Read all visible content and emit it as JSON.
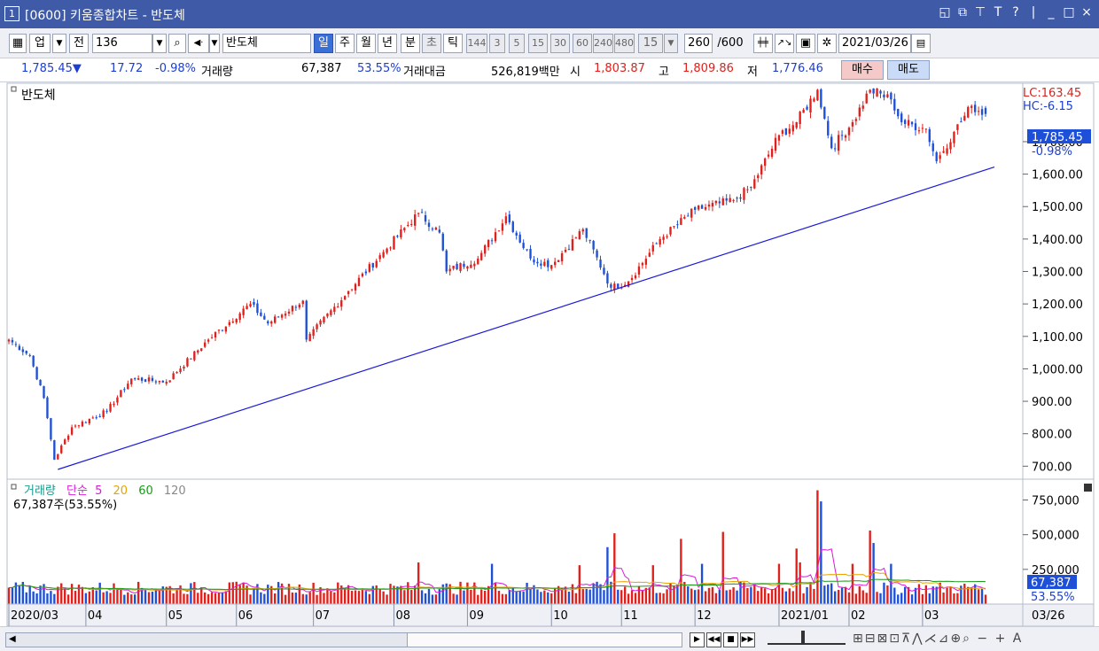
{
  "window": {
    "number": "1",
    "title": "[0600] 키움종합차트 - 반도체"
  },
  "toolbar": {
    "type_label": "업",
    "prev_label": "전",
    "code_value": "136",
    "name_value": "반도체",
    "periods": [
      "일",
      "주",
      "월",
      "년",
      "분",
      "초",
      "틱"
    ],
    "active_period": "일",
    "intervals": [
      "144",
      "3",
      "5",
      "15",
      "30",
      "60",
      "240",
      "480"
    ],
    "interval_value": "15",
    "count_value": "260",
    "count_total": "/600",
    "date_value": "2021/03/26"
  },
  "quote": {
    "price": "1,785.45▼",
    "change": "17.72",
    "change_pct": "-0.98%",
    "volume_label": "거래량",
    "volume": "67,387",
    "volume_ratio": "53.55%",
    "amount_label": "거래대금",
    "amount": "526,819백만",
    "open_label": "시",
    "open": "1,803.87",
    "high_label": "고",
    "high": "1,809.86",
    "low_label": "저",
    "low": "1,776.46",
    "buy_label": "매수",
    "sell_label": "매도"
  },
  "colors": {
    "up": "#e0201c",
    "down": "#1d4fd8",
    "trend": "#1a1ad8",
    "ma5": "#d81ad8",
    "ma20": "#e8a400",
    "ma60": "#1a9a1a",
    "ma120": "#888888",
    "title_bar": "#3f5aa6"
  },
  "chart_data": [
    {
      "type": "candlestick",
      "title": "반도체",
      "lc": "LC:163.45",
      "hc": "HC:-6.15",
      "last_price": "1,785.45",
      "last_change": "-0.98%",
      "ylim": [
        660,
        1880
      ],
      "yticks": [
        "1,700.00",
        "1,600.00",
        "1,500.00",
        "1,400.00",
        "1,300.00",
        "1,200.00",
        "1,100.00",
        "1,000.00",
        "900.00",
        "800.00",
        "700.00"
      ],
      "ytick_values": [
        1700,
        1600,
        1500,
        1400,
        1300,
        1200,
        1100,
        1000,
        900,
        800,
        700
      ],
      "x_labels": [
        "2020/03",
        "04",
        "05",
        "06",
        "07",
        "08",
        "09",
        "10",
        "11",
        "12",
        "2021/01",
        "02",
        "03"
      ],
      "x_label_dates": [
        "2020-03-02",
        "2020-04-01",
        "2020-05-04",
        "2020-06-01",
        "2020-07-01",
        "2020-08-03",
        "2020-09-01",
        "2020-10-05",
        "2020-11-02",
        "2020-12-01",
        "2021-01-04",
        "2021-02-01",
        "2021-03-02"
      ],
      "last_x_label": "03/26",
      "anchors": [
        {
          "date": "2020-03-02",
          "close": 1090
        },
        {
          "date": "2020-03-10",
          "close": 1040
        },
        {
          "date": "2020-03-16",
          "close": 910
        },
        {
          "date": "2020-03-19",
          "close": 720
        },
        {
          "date": "2020-03-26",
          "close": 820
        },
        {
          "date": "2020-04-09",
          "close": 870
        },
        {
          "date": "2020-04-20",
          "close": 970
        },
        {
          "date": "2020-05-04",
          "close": 960
        },
        {
          "date": "2020-05-20",
          "close": 1090
        },
        {
          "date": "2020-06-05",
          "close": 1200
        },
        {
          "date": "2020-06-12",
          "close": 1140
        },
        {
          "date": "2020-06-26",
          "close": 1210
        },
        {
          "date": "2020-06-29",
          "close": 1090
        },
        {
          "date": "2020-07-15",
          "close": 1240
        },
        {
          "date": "2020-07-29",
          "close": 1360
        },
        {
          "date": "2020-08-12",
          "close": 1480
        },
        {
          "date": "2020-08-20",
          "close": 1420
        },
        {
          "date": "2020-08-24",
          "close": 1300
        },
        {
          "date": "2020-09-04",
          "close": 1340
        },
        {
          "date": "2020-09-16",
          "close": 1470
        },
        {
          "date": "2020-09-25",
          "close": 1340
        },
        {
          "date": "2020-10-05",
          "close": 1320
        },
        {
          "date": "2020-10-16",
          "close": 1430
        },
        {
          "date": "2020-10-28",
          "close": 1250
        },
        {
          "date": "2020-11-04",
          "close": 1270
        },
        {
          "date": "2020-11-17",
          "close": 1400
        },
        {
          "date": "2020-12-01",
          "close": 1490
        },
        {
          "date": "2020-12-16",
          "close": 1520
        },
        {
          "date": "2020-12-23",
          "close": 1560
        },
        {
          "date": "2021-01-04",
          "close": 1720
        },
        {
          "date": "2021-01-11",
          "close": 1760
        },
        {
          "date": "2021-01-19",
          "close": 1860
        },
        {
          "date": "2021-01-25",
          "close": 1680
        },
        {
          "date": "2021-02-02",
          "close": 1760
        },
        {
          "date": "2021-02-09",
          "close": 1860
        },
        {
          "date": "2021-02-17",
          "close": 1830
        },
        {
          "date": "2021-02-22",
          "close": 1760
        },
        {
          "date": "2021-03-03",
          "close": 1740
        },
        {
          "date": "2021-03-08",
          "close": 1640
        },
        {
          "date": "2021-03-15",
          "close": 1730
        },
        {
          "date": "2021-03-22",
          "close": 1810
        },
        {
          "date": "2021-03-26",
          "close": 1785.45
        }
      ],
      "last_candle": {
        "open": 1803.87,
        "high": 1809.86,
        "low": 1776.46,
        "close": 1785.45
      },
      "trendline": [
        {
          "date": "2020-03-20",
          "value": 690
        },
        {
          "date": "2021-03-26",
          "value": 1622
        }
      ]
    },
    {
      "type": "bar",
      "title": "거래량",
      "legend": [
        "거래량",
        "단순",
        "5",
        "20",
        "60",
        "120"
      ],
      "last_label": "67,387주(53.55%)",
      "last_value_label": "67,387",
      "last_ratio_label": "53.55%",
      "ylim": [
        0,
        900000
      ],
      "yticks": [
        "750,000",
        "500,000",
        "250,000"
      ],
      "ytick_values": [
        750000,
        500000,
        250000
      ],
      "base_volume": 120000,
      "spikes": [
        {
          "date": "2020-08-12",
          "volume": 300000
        },
        {
          "date": "2020-09-10",
          "volume": 290000
        },
        {
          "date": "2020-10-15",
          "volume": 280000
        },
        {
          "date": "2020-10-27",
          "volume": 410000
        },
        {
          "date": "2020-10-29",
          "volume": 510000
        },
        {
          "date": "2020-11-13",
          "volume": 280000
        },
        {
          "date": "2020-11-25",
          "volume": 470000
        },
        {
          "date": "2020-12-03",
          "volume": 290000
        },
        {
          "date": "2020-12-11",
          "volume": 520000
        },
        {
          "date": "2021-01-04",
          "volume": 290000
        },
        {
          "date": "2021-01-11",
          "volume": 400000
        },
        {
          "date": "2021-01-12",
          "volume": 300000
        },
        {
          "date": "2021-01-19",
          "volume": 820000
        },
        {
          "date": "2021-01-20",
          "volume": 740000
        },
        {
          "date": "2021-02-02",
          "volume": 290000
        },
        {
          "date": "2021-02-09",
          "volume": 530000
        },
        {
          "date": "2021-02-10",
          "volume": 440000
        },
        {
          "date": "2021-02-17",
          "volume": 290000
        }
      ],
      "last_volume": 67387
    }
  ]
}
